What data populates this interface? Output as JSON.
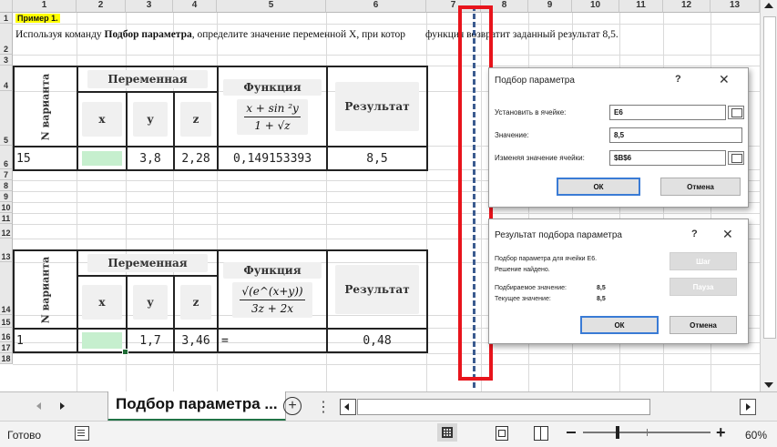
{
  "columns": [
    "1",
    "2",
    "3",
    "4",
    "5",
    "6",
    "7",
    "8",
    "9",
    "10",
    "11",
    "12",
    "13"
  ],
  "rows": [
    "1",
    "2",
    "3",
    "4",
    "5",
    "6",
    "7",
    "8",
    "9",
    "10",
    "11",
    "12",
    "13",
    "14",
    "15",
    "16",
    "17",
    "18"
  ],
  "sheet": {
    "example_title": "Пример 1.",
    "instruction_pre": "Используя команду ",
    "instruction_bold": "Подбор параметра",
    "instruction_post": ", определите значение переменной X, при котор",
    "instruction_tail": "функция возвратит заданный результат 8,5."
  },
  "table1": {
    "no_header": "N варианта",
    "variable_header": "Переменная",
    "function_header": "Функция",
    "result_header": "Результат",
    "col_x": "x",
    "col_y": "y",
    "col_z": "z",
    "formula_num": "x + sin ²y",
    "formula_den": "1 + √z",
    "variant": "15",
    "x_value": "",
    "y_value": "3,8",
    "z_value": "2,28",
    "function_value": "0,149153393",
    "result_value": "8,5"
  },
  "table2": {
    "no_header": "N варианта",
    "variable_header": "Переменная",
    "function_header": "Функция",
    "result_header": "Результат",
    "col_x": "x",
    "col_y": "y",
    "col_z": "z",
    "formula_num": "√(e^(x+y))",
    "formula_den": "3z + 2x",
    "variant": "1",
    "x_value": "",
    "y_value": "1,7",
    "z_value": "3,46",
    "function_value": "=",
    "result_value": "0,48"
  },
  "goal_seek_dialog": {
    "title": "Подбор параметра",
    "help": "?",
    "close": "✕",
    "set_cell_label": "Установить в ячейке:",
    "set_cell_value": "E6",
    "value_label": "Значение:",
    "value_value": "8,5",
    "changing_label": "Изменяя значение ячейки:",
    "changing_value": "$B$6",
    "ok": "ОК",
    "cancel": "Отмена"
  },
  "status_dialog": {
    "title": "Результат подбора параметра",
    "help": "?",
    "close": "✕",
    "line1": "Подбор параметра для ячейки E6.",
    "line2": "Решение найдено.",
    "target_label": "Подбираемое значение:",
    "target_value": "8,5",
    "current_label": "Текущее значение:",
    "current_value": "8,5",
    "step": "Шаг",
    "pause": "Пауза",
    "ok": "ОК",
    "cancel": "Отмена"
  },
  "tabs": {
    "active_sheet": "Подбор параметра ...",
    "add": "+",
    "more": "⋮"
  },
  "statusbar": {
    "ready": "Готово",
    "zoom": "60%"
  },
  "colors": {
    "highlight_yellow": "#ffff00",
    "input_green": "#c6efce",
    "annotation_red": "#e8141c",
    "dashed_blue": "#3b5b8f"
  }
}
